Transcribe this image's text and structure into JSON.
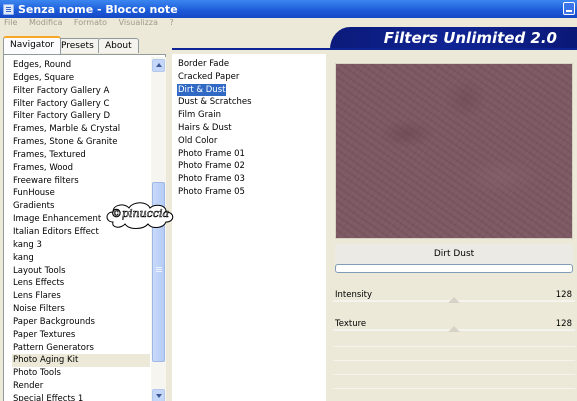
{
  "window": {
    "title": "Senza nome - Blocco note",
    "menu": [
      "File",
      "Modifica",
      "Formato",
      "Visualizza",
      "?"
    ]
  },
  "plugin": {
    "header_title": "Filters Unlimited 2.0",
    "tabs": [
      "Navigator",
      "Presets",
      "About"
    ],
    "active_tab": "Navigator"
  },
  "categories": [
    "Edges, Round",
    "Edges, Square",
    "Filter Factory Gallery A",
    "Filter Factory Gallery C",
    "Filter Factory Gallery D",
    "Frames, Marble & Crystal",
    "Frames, Stone & Granite",
    "Frames, Textured",
    "Frames, Wood",
    "Freeware filters",
    "FunHouse",
    "Gradients",
    "Image Enhancement",
    "Italian Editors Effect",
    "kang 3",
    "kang",
    "Layout Tools",
    "Lens Effects",
    "Lens Flares",
    "Noise Filters",
    "Paper Backgrounds",
    "Paper Textures",
    "Pattern Generators",
    "Photo Aging Kit",
    "Photo Tools",
    "Render",
    "Special Effects 1"
  ],
  "selected_category": "Photo Aging Kit",
  "effects": [
    "Border Fade",
    "Cracked Paper",
    "Dirt & Dust",
    "Dust & Scratches",
    "Film Grain",
    "Hairs & Dust",
    "Old Color",
    "Photo Frame 01",
    "Photo Frame 02",
    "Photo Frame 03",
    "Photo Frame 05"
  ],
  "selected_effect": "Dirt & Dust",
  "preview": {
    "filter_name": "Dirt  Dust",
    "progress": 0
  },
  "sliders": [
    {
      "label": "Intensity",
      "value": "128",
      "level": 128,
      "max": 255
    },
    {
      "label": "Texture",
      "value": "128",
      "level": 128,
      "max": 255
    }
  ],
  "watermark_text": "©pinuccia",
  "colors": {
    "header_blue": "#0f2494",
    "selection_blue": "#316ac5",
    "preview_mauve": "#7d5a64",
    "tab_highlight": "#f5a623"
  }
}
